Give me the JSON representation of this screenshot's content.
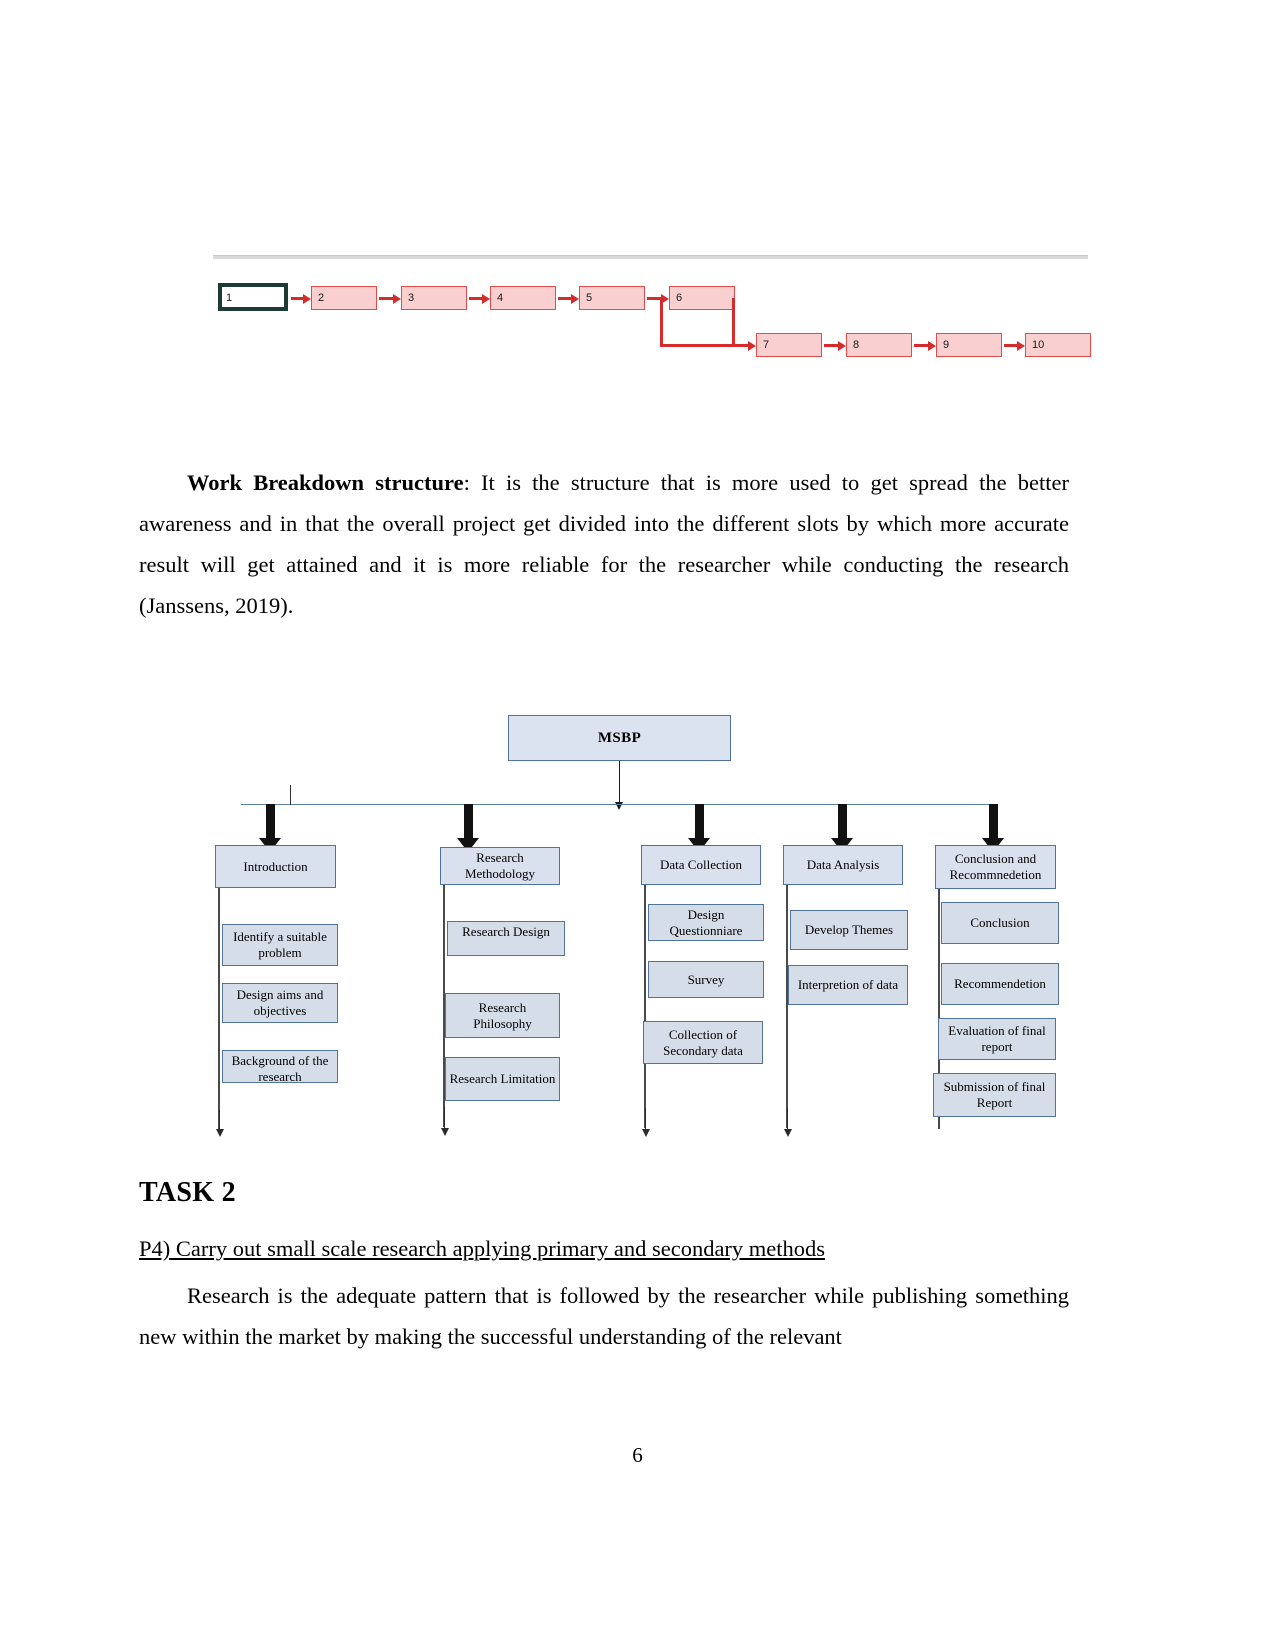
{
  "document": {
    "page_number": "6"
  },
  "network_diagram": {
    "name": "precedence-network-diagram",
    "nodes": [
      {
        "id": "1",
        "label": "1",
        "critical": true
      },
      {
        "id": "2",
        "label": "2",
        "critical": false
      },
      {
        "id": "3",
        "label": "3",
        "critical": false
      },
      {
        "id": "4",
        "label": "4",
        "critical": false
      },
      {
        "id": "5",
        "label": "5",
        "critical": false
      },
      {
        "id": "6",
        "label": "6",
        "critical": false
      },
      {
        "id": "7",
        "label": "7",
        "critical": false
      },
      {
        "id": "8",
        "label": "8",
        "critical": false
      },
      {
        "id": "9",
        "label": "9",
        "critical": false
      },
      {
        "id": "10",
        "label": "10",
        "critical": false
      }
    ],
    "colors": {
      "node_fill": "#f9cfcf",
      "node_border": "#e04b4b",
      "arrow": "#d62b2b",
      "critical_border": "#1b3b34"
    }
  },
  "paragraphs": {
    "wbs_intro_bold": "Work Breakdown structure",
    "wbs_intro_rest": ": It is the structure that is more used to get spread the better awareness and in that the overall project get divided into the different slots by which more accurate result will get attained and it is more reliable for the researcher while conducting the research (Janssens, 2019).",
    "research_body": "Research is the adequate pattern that is followed by the researcher while publishing something new within the market by making the successful understanding of the relevant"
  },
  "wbs": {
    "root": "MSBP",
    "colors": {
      "box_fill": "#d9e0ee",
      "box_border": "#4f7399",
      "connector": "#5b81a6"
    },
    "branches": [
      {
        "title": "Introduction",
        "children": [
          "Identify a suitable problem",
          "Design aims and objectives",
          "Background of the research"
        ]
      },
      {
        "title": "Research Methodology",
        "children": [
          "Research Design",
          "Research Philosophy",
          "Research Limitation"
        ]
      },
      {
        "title": "Data Collection",
        "children": [
          "Design Questionniare",
          "Survey",
          "Collection of Secondary data"
        ]
      },
      {
        "title": "Data Analysis",
        "children": [
          "Develop Themes",
          "Interpretion of data"
        ]
      },
      {
        "title": "Conclusion and Recommnedetion",
        "children": [
          "Conclusion",
          "Recommendetion",
          "Evaluation of final report",
          "Submission of final Report"
        ]
      }
    ]
  },
  "headings": {
    "task": "TASK 2",
    "p4": "P4) Carry out small scale research applying primary and secondary methods"
  }
}
